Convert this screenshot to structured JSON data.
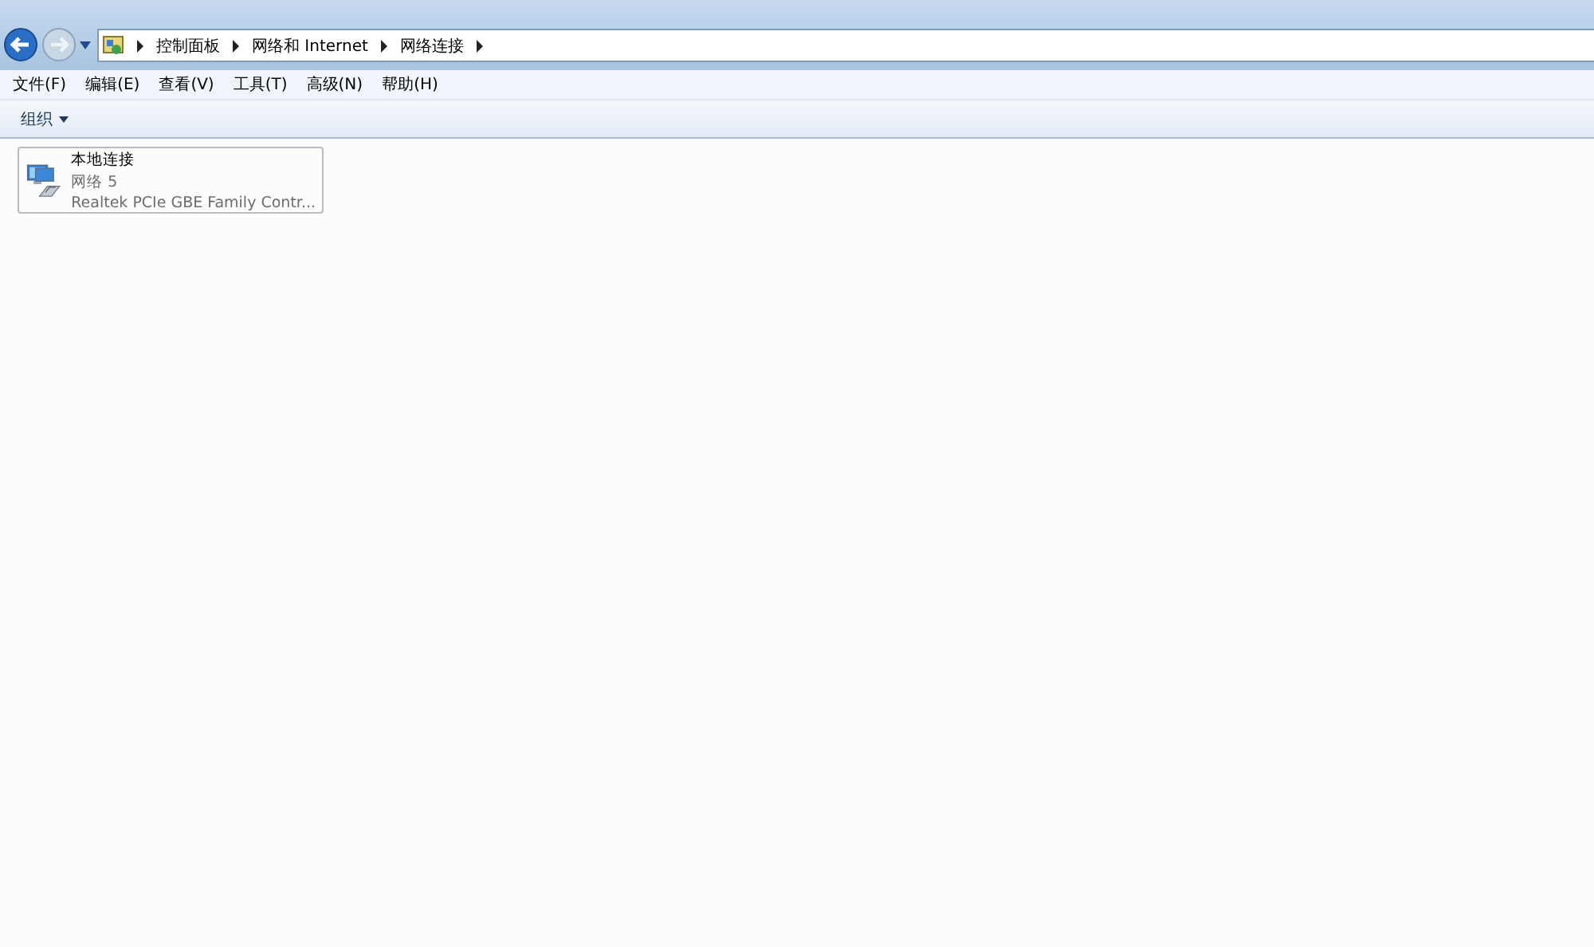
{
  "breadcrumb": [
    "控制面板",
    "网络和 Internet",
    "网络连接"
  ],
  "menu": [
    "文件(F)",
    "编辑(E)",
    "查看(V)",
    "工具(T)",
    "高级(N)",
    "帮助(H)"
  ],
  "toolbar": {
    "organize": "组织"
  },
  "connections": [
    {
      "name": "本地连接",
      "network": "网络  5",
      "adapter": "Realtek PCIe GBE Family Contr..."
    }
  ]
}
